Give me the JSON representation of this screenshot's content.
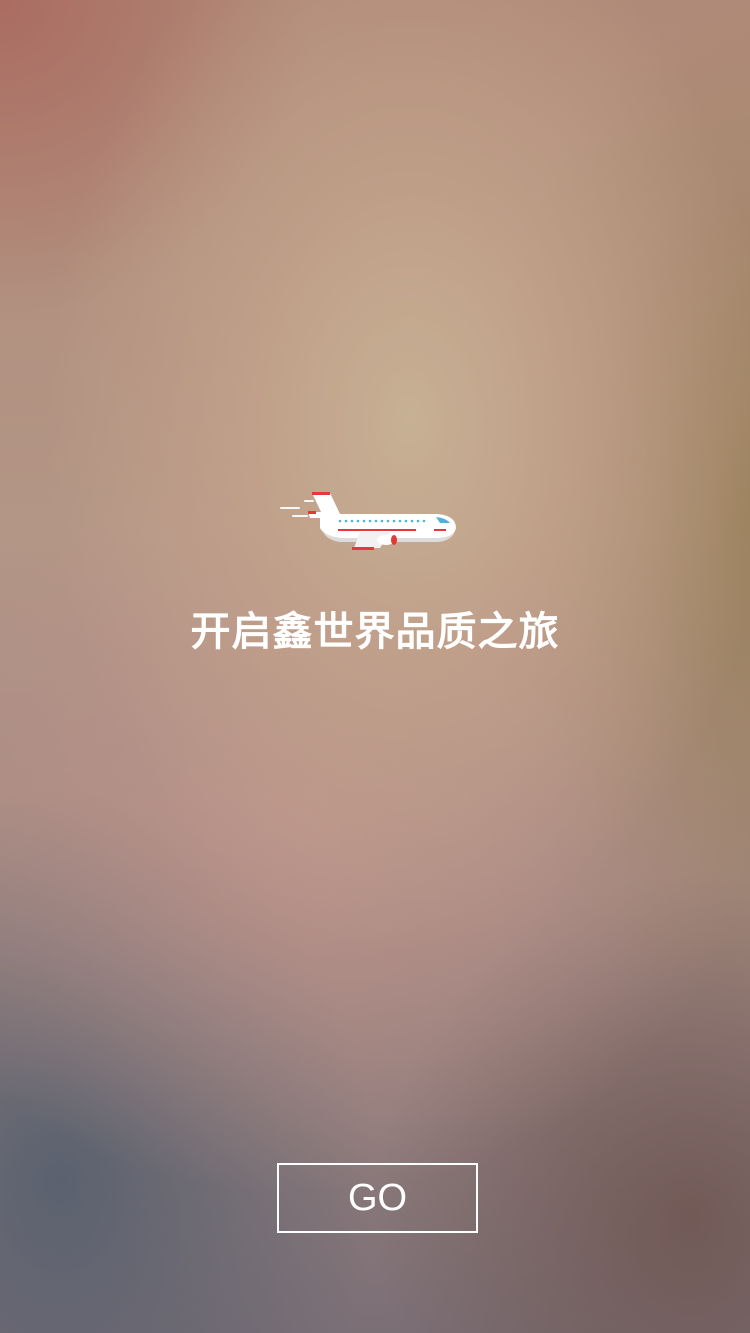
{
  "splash": {
    "slogan": "开启鑫世界品质之旅",
    "go_button_label": "GO",
    "hero_icon": "airplane-icon"
  },
  "colors": {
    "text": "#ffffff",
    "plane_body": "#ffffff",
    "plane_accent": "#e53935",
    "plane_window": "#4fb3d9"
  }
}
